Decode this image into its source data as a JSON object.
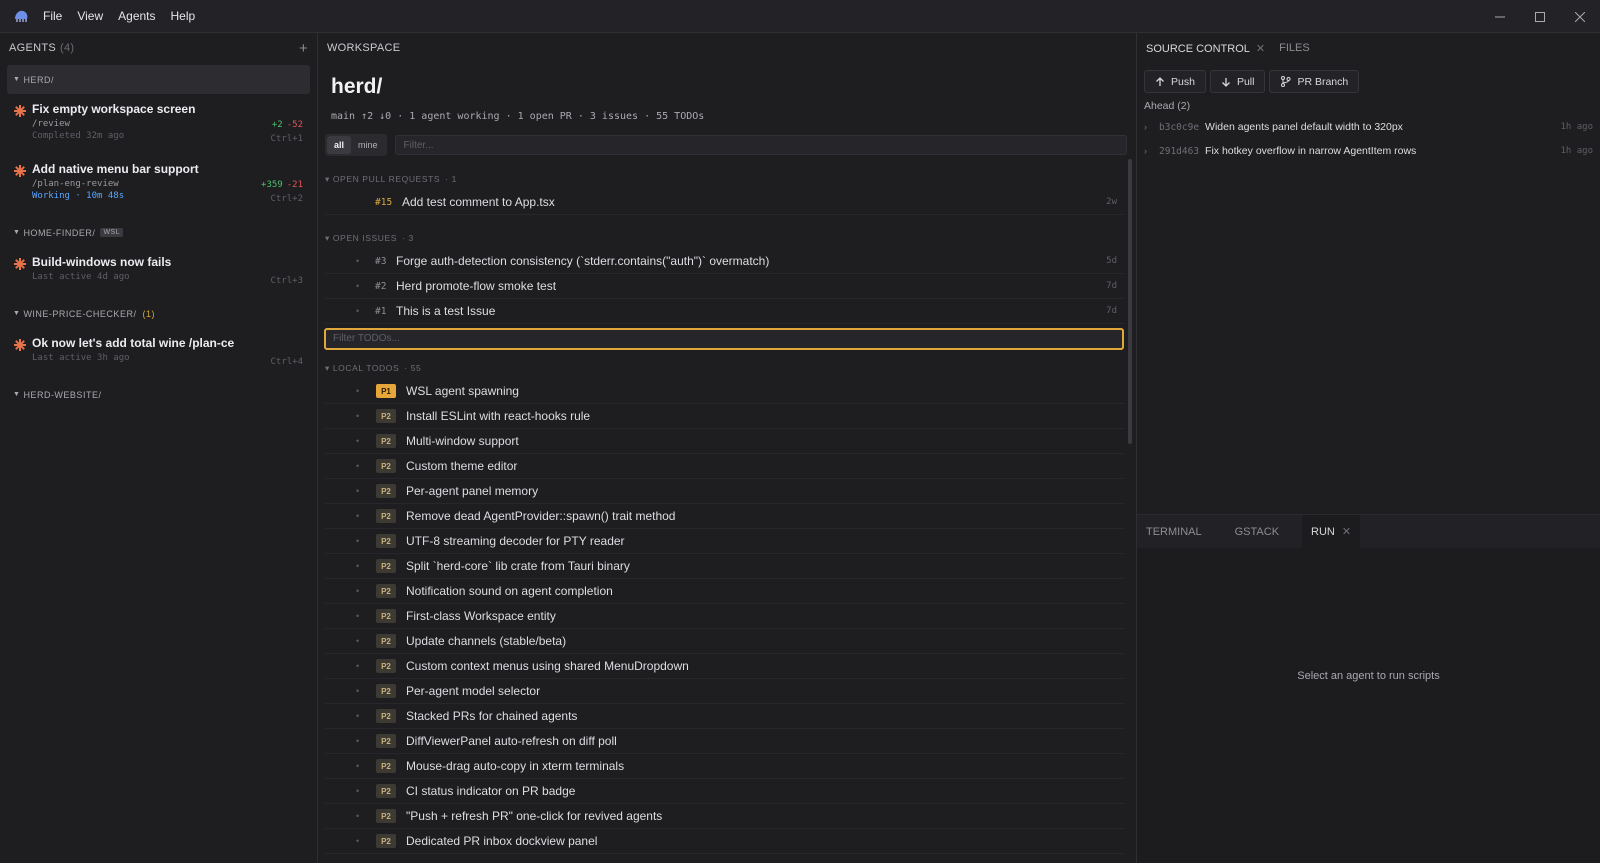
{
  "menu": [
    "File",
    "View",
    "Agents",
    "Help"
  ],
  "window_controls": [
    "minimize-icon",
    "maximize-icon",
    "close-icon"
  ],
  "agents_panel": {
    "title": "AGENTS",
    "count": "(4)",
    "groups": [
      {
        "name": "HERD/",
        "agents": [
          {
            "title": "Fix empty workspace screen",
            "command": "/review",
            "status": "Completed 32m ago",
            "added": "+2",
            "removed": "-52",
            "hotkey": "Ctrl+1"
          },
          {
            "title": "Add native menu bar support",
            "command": "/plan-eng-review",
            "status": "Working · 10m 48s",
            "added": "+359",
            "removed": "-21",
            "hotkey": "Ctrl+2"
          }
        ]
      },
      {
        "name": "HOME-FINDER/",
        "tag": "WSL",
        "agents": [
          {
            "title": "Build-windows now fails",
            "status": "Last active 4d ago",
            "hotkey": "Ctrl+3"
          }
        ]
      },
      {
        "name": "WINE-PRICE-CHECKER/",
        "count": "(1)",
        "agents": [
          {
            "title": "Ok now let's add total wine /plan-ce",
            "status": "Last active 3h ago",
            "hotkey": "Ctrl+4"
          }
        ]
      },
      {
        "name": "HERD-WEBSITE/"
      }
    ]
  },
  "workspace": {
    "header": "WORKSPACE",
    "title": "herd/",
    "meta": "main ↑2 ↓0 · 1 agent working · 1 open PR · 3 issues · 55 TODOs",
    "seg_all": "all",
    "seg_mine": "mine",
    "filter_placeholder": "Filter...",
    "pr_label": "OPEN PULL REQUESTS",
    "pr_count": "1",
    "prs": [
      {
        "num": "#15",
        "title": "Add test comment to App.tsx",
        "age": "2w"
      }
    ],
    "issues_label": "OPEN ISSUES",
    "issues_count": "3",
    "issues": [
      {
        "num": "#3",
        "title": "Forge auth-detection consistency (`stderr.contains(\"auth\")` overmatch)",
        "age": "5d"
      },
      {
        "num": "#2",
        "title": "Herd promote-flow smoke test",
        "age": "7d"
      },
      {
        "num": "#1",
        "title": "This is a test Issue",
        "age": "7d"
      }
    ],
    "todo_filter_placeholder": "Filter TODOs...",
    "todos_label": "LOCAL TODOS",
    "todos_count": "55",
    "todos": [
      {
        "p": "P1",
        "title": "WSL agent spawning"
      },
      {
        "p": "P2",
        "title": "Install ESLint with react-hooks rule"
      },
      {
        "p": "P2",
        "title": "Multi-window support"
      },
      {
        "p": "P2",
        "title": "Custom theme editor"
      },
      {
        "p": "P2",
        "title": "Per-agent panel memory"
      },
      {
        "p": "P2",
        "title": "Remove dead AgentProvider::spawn() trait method"
      },
      {
        "p": "P2",
        "title": "UTF-8 streaming decoder for PTY reader"
      },
      {
        "p": "P2",
        "title": "Split `herd-core` lib crate from Tauri binary"
      },
      {
        "p": "P2",
        "title": "Notification sound on agent completion"
      },
      {
        "p": "P2",
        "title": "First-class Workspace entity"
      },
      {
        "p": "P2",
        "title": "Update channels (stable/beta)"
      },
      {
        "p": "P2",
        "title": "Custom context menus using shared MenuDropdown"
      },
      {
        "p": "P2",
        "title": "Per-agent model selector"
      },
      {
        "p": "P2",
        "title": "Stacked PRs for chained agents"
      },
      {
        "p": "P2",
        "title": "DiffViewerPanel auto-refresh on diff poll"
      },
      {
        "p": "P2",
        "title": "Mouse-drag auto-copy in xterm terminals"
      },
      {
        "p": "P2",
        "title": "CI status indicator on PR badge"
      },
      {
        "p": "P2",
        "title": "\"Push + refresh PR\" one-click for revived agents"
      },
      {
        "p": "P2",
        "title": "Dedicated PR inbox dockview panel"
      }
    ]
  },
  "source_control": {
    "tab_label": "SOURCE CONTROL",
    "files_tab": "FILES",
    "push": "Push",
    "pull": "Pull",
    "pr_branch": "PR Branch",
    "ahead": "Ahead (2)",
    "commits": [
      {
        "sha": "b3c0c9e",
        "msg": "Widen agents panel default width to 320px",
        "when": "1h ago"
      },
      {
        "sha": "291d463",
        "msg": "Fix hotkey overflow in narrow AgentItem rows",
        "when": "1h ago"
      }
    ]
  },
  "bottom": {
    "tabs": [
      "TERMINAL",
      "GSTACK",
      "RUN"
    ],
    "empty_text": "Select an agent to run scripts"
  },
  "colors": {
    "accent": "#e0a83a",
    "working": "#58a6ff",
    "added": "#4cc06a",
    "removed": "#e05555",
    "agent_icon": "#e8734a"
  }
}
